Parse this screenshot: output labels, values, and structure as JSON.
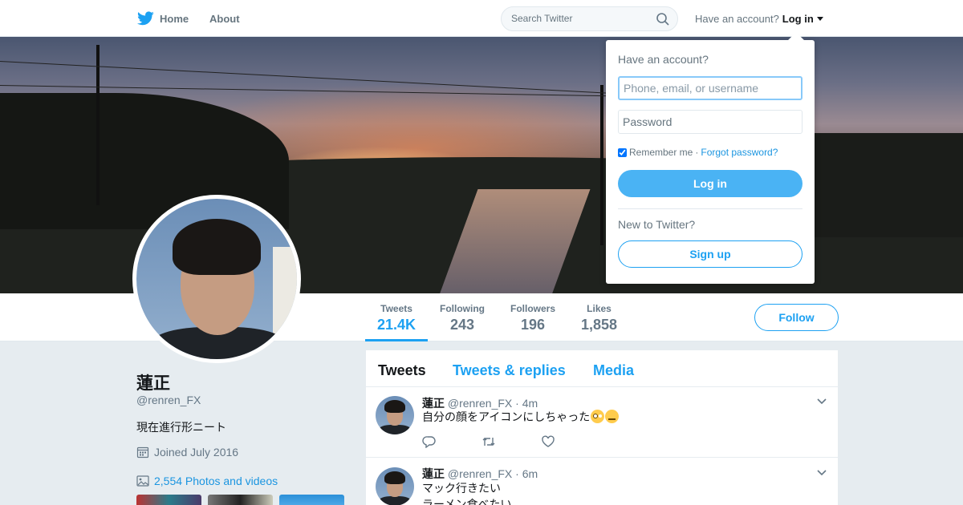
{
  "nav": {
    "home_label": "Home",
    "about_label": "About",
    "search_placeholder": "Search Twitter",
    "have_account": "Have an account?",
    "login_label": "Log in"
  },
  "profile": {
    "name": "蓮正",
    "handle": "@renren_FX",
    "bio": "現在進行形ニート",
    "joined": "Joined July 2016",
    "photos_link": "2,554 Photos and videos",
    "stats": [
      {
        "label": "Tweets",
        "value": "21.4K"
      },
      {
        "label": "Following",
        "value": "243"
      },
      {
        "label": "Followers",
        "value": "196"
      },
      {
        "label": "Likes",
        "value": "1,858"
      }
    ],
    "follow_label": "Follow"
  },
  "timeline": {
    "tabs": [
      "Tweets",
      "Tweets & replies",
      "Media"
    ],
    "tweets": [
      {
        "name": "蓮正",
        "handle": "@renren_FX",
        "time": "· 4m",
        "text": "自分の顔をアイコンにしちゃった",
        "emojis": [
          "flushed-face",
          "neutral-face"
        ]
      },
      {
        "name": "蓮正",
        "handle": "@renren_FX",
        "time": "· 6m",
        "text": "マック行きたい",
        "text2": "ラーメン食べたい"
      }
    ]
  },
  "login_dropdown": {
    "title": "Have an account?",
    "username_placeholder": "Phone, email, or username",
    "password_placeholder": "Password",
    "remember_label": "Remember me",
    "separator": "·",
    "forgot_label": "Forgot password?",
    "login_button": "Log in",
    "new_label": "New to Twitter?",
    "signup_button": "Sign up"
  },
  "colors": {
    "brand_blue": "#1da1f2",
    "login_button": "#4ab3f4",
    "background": "#e6ecf0"
  }
}
